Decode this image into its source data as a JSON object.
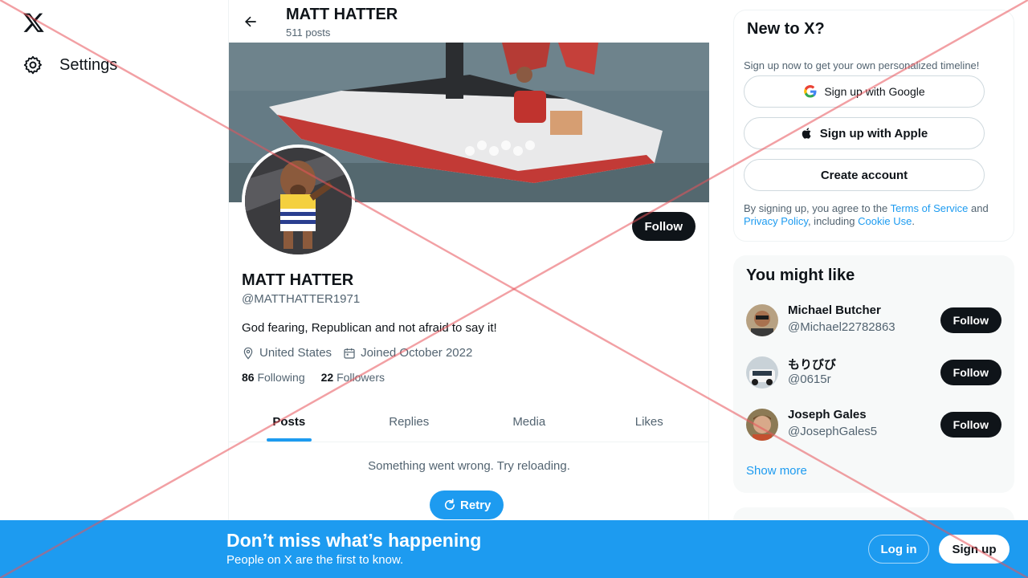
{
  "nav": {
    "settings_label": "Settings"
  },
  "profile": {
    "top_name": "MATT HATTER",
    "post_count": "511 posts",
    "name": "MATT HATTER",
    "handle": "@MATTHATTER1971",
    "bio": "God fearing, Republican and not afraid to say it!",
    "location": "United States",
    "joined": "Joined October 2022",
    "following_count": "86",
    "following_label": "Following",
    "followers_count": "22",
    "followers_label": "Followers",
    "follow_label": "Follow"
  },
  "tabs": [
    {
      "label": "Posts",
      "active": true
    },
    {
      "label": "Replies",
      "active": false
    },
    {
      "label": "Media",
      "active": false
    },
    {
      "label": "Likes",
      "active": false
    }
  ],
  "feed": {
    "error_text": "Something went wrong. Try reloading.",
    "retry_label": "Retry"
  },
  "signup_card": {
    "title": "New to X?",
    "subtitle": "Sign up now to get your own personalized timeline!",
    "google_label": "Sign up with Google",
    "apple_label": "Sign up with Apple",
    "create_label": "Create account",
    "legal_prefix": "By signing up, you agree to the ",
    "terms_label": "Terms of Service",
    "legal_and": " and ",
    "privacy_label": "Privacy Policy",
    "legal_including": ", including ",
    "cookie_label": "Cookie Use",
    "legal_end": "."
  },
  "suggestions": {
    "title": "You might like",
    "users": [
      {
        "name": "Michael Butcher",
        "handle": "@Michael22782863",
        "follow_label": "Follow"
      },
      {
        "name": "もりびび",
        "handle": "@0615r",
        "follow_label": "Follow"
      },
      {
        "name": "Joseph Gales",
        "handle": "@JosephGales5",
        "follow_label": "Follow"
      }
    ],
    "show_more": "Show more"
  },
  "bottom_bar": {
    "title": "Don’t miss what’s happening",
    "subtitle": "People on X are the first to know.",
    "login_label": "Log in",
    "signup_label": "Sign up"
  },
  "colors": {
    "accent": "#1d9bf0",
    "text": "#0f1419",
    "muted": "#536471",
    "overlay_x": "#e8545a"
  },
  "icons": [
    "x-logo-icon",
    "gear-icon",
    "back-arrow-icon",
    "location-pin-icon",
    "calendar-icon",
    "google-icon",
    "apple-icon",
    "refresh-icon"
  ]
}
